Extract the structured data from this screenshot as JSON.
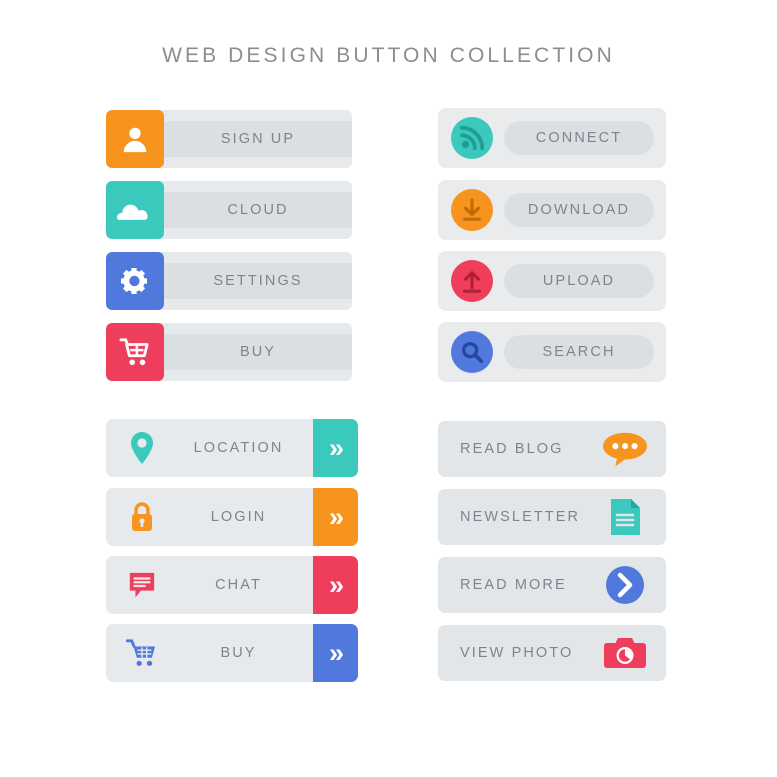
{
  "page": {
    "title": "WEB DESIGN BUTTON COLLECTION",
    "background": "#ffffff",
    "title_color": "#8d8d8d",
    "label_color": "#7b8490",
    "panel_light": "#e7eaec",
    "panel_band": "#dbdfe1"
  },
  "colors": {
    "orange": "#f7941e",
    "teal": "#3ac9bc",
    "blue": "#5179dd",
    "red": "#ef3e5c"
  },
  "groups": {
    "left_top": {
      "name": "square-icon-buttons",
      "buttons": [
        {
          "label": "SIGN UP",
          "icon": "user-icon",
          "color": "#f7941e"
        },
        {
          "label": "CLOUD",
          "icon": "cloud-icon",
          "color": "#3ac9bc"
        },
        {
          "label": "SETTINGS",
          "icon": "gear-icon",
          "color": "#5179dd"
        },
        {
          "label": "BUY",
          "icon": "cart-icon",
          "color": "#ef3e5c"
        }
      ]
    },
    "right_top": {
      "name": "circle-icon-pill-buttons",
      "buttons": [
        {
          "label": "CONNECT",
          "icon": "rss-icon",
          "color": "#3ac9bc"
        },
        {
          "label": "DOWNLOAD",
          "icon": "download-arrow-icon",
          "color": "#f7941e"
        },
        {
          "label": "UPLOAD",
          "icon": "upload-arrow-icon",
          "color": "#ef3e5c"
        },
        {
          "label": "SEARCH",
          "icon": "magnifier-icon",
          "color": "#5179dd"
        }
      ]
    },
    "left_bottom": {
      "name": "chevron-action-buttons",
      "chevron_glyph": "»",
      "buttons": [
        {
          "label": "LOCATION",
          "icon": "map-pin-icon",
          "color": "#3ac9bc"
        },
        {
          "label": "LOGIN",
          "icon": "lock-icon",
          "color": "#f7941e"
        },
        {
          "label": "CHAT",
          "icon": "chat-bubble-icon",
          "color": "#ef3e5c"
        },
        {
          "label": "BUY",
          "icon": "shopping-cart-icon",
          "color": "#5179dd"
        }
      ]
    },
    "right_bottom": {
      "name": "text-left-icon-right-buttons",
      "buttons": [
        {
          "label": "READ BLOG",
          "icon": "speech-bubble-icon",
          "color": "#f7941e"
        },
        {
          "label": "NEWSLETTER",
          "icon": "document-icon",
          "color": "#3ac9bc"
        },
        {
          "label": "READ MORE",
          "icon": "chevron-circle-icon",
          "color": "#5179dd"
        },
        {
          "label": "VIEW PHOTO",
          "icon": "camera-icon",
          "color": "#ef3e5c"
        }
      ]
    }
  }
}
